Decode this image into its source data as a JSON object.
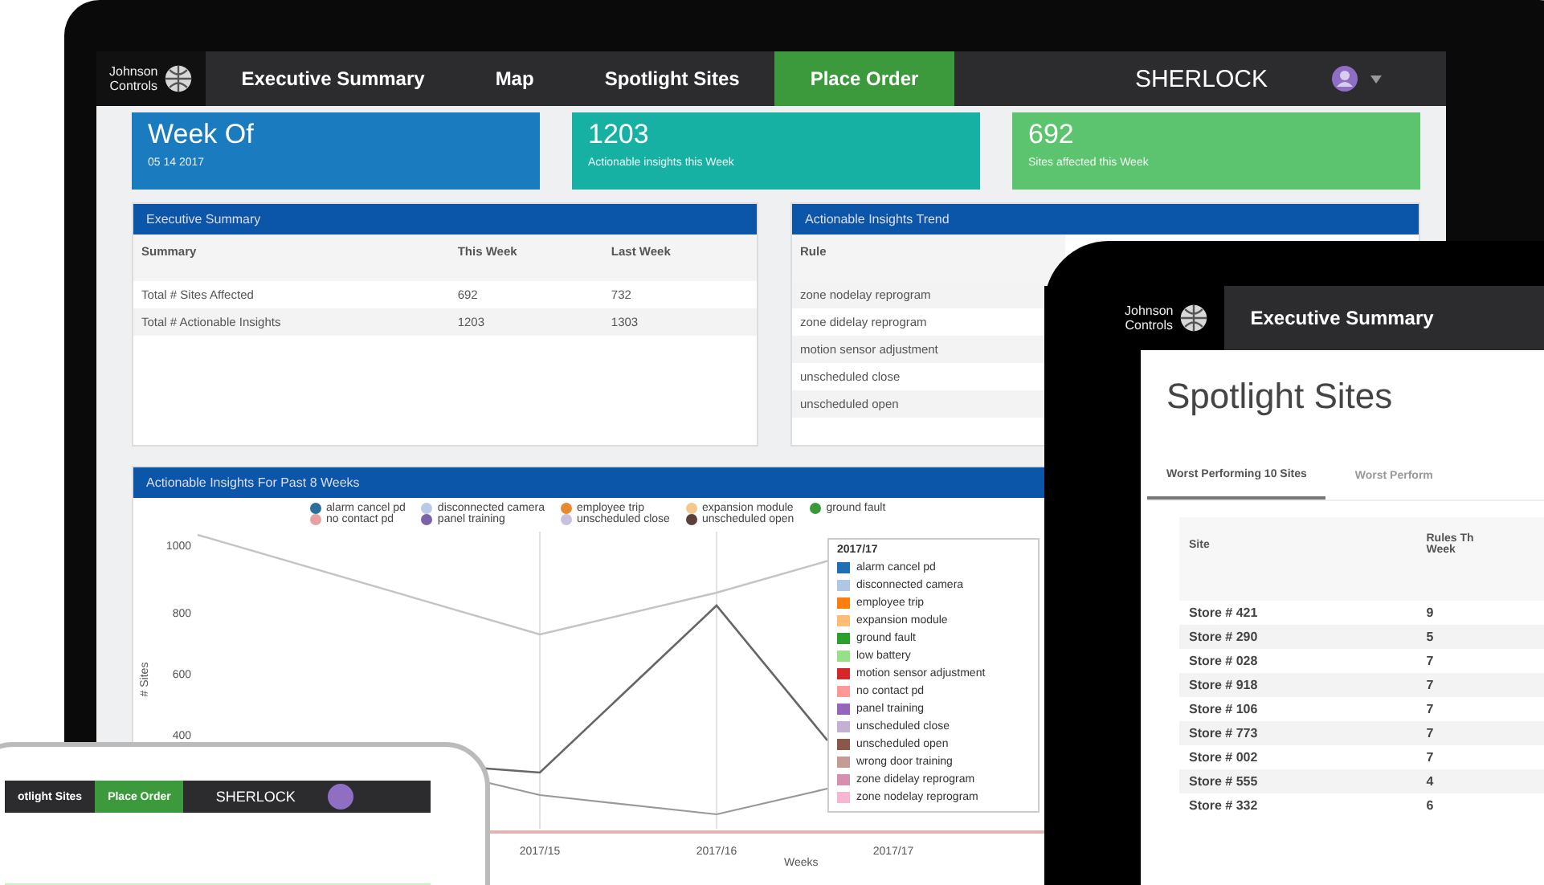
{
  "monitor": {
    "nav": {
      "logo_lines": [
        "Johnson",
        "Controls"
      ],
      "tabs": [
        {
          "label": "Executive Summary",
          "selected": false
        },
        {
          "label": "Map",
          "selected": false
        },
        {
          "label": "Spotlight Sites",
          "selected": false
        },
        {
          "label": "Place Order",
          "selected": true
        }
      ],
      "brand": "SHERLOCK"
    },
    "cards": [
      {
        "value": "Week Of",
        "caption": "05 14 2017",
        "color": "#1b7bbf"
      },
      {
        "value": "1203",
        "caption": "Actionable insights this Week",
        "color": "#17b1a3"
      },
      {
        "value": "692",
        "caption": "Sites affected this Week",
        "color": "#5cc46f"
      }
    ],
    "summary_panel": {
      "title": "Executive Summary",
      "columns": [
        "Summary",
        "This Week",
        "Last Week"
      ],
      "rows": [
        [
          "Total # Sites Affected",
          "692",
          "732"
        ],
        [
          "Total # Actionable Insights",
          "1203",
          "1303"
        ]
      ]
    },
    "trend_panel": {
      "title": "Actionable Insights Trend",
      "columns": [
        "Rule"
      ],
      "rows": [
        "zone nodelay reprogram",
        "zone didelay reprogram",
        "motion sensor adjustment",
        "unscheduled close",
        "unscheduled open"
      ]
    },
    "chart_panel": {
      "title": "Actionable Insights For Past 8 Weeks",
      "legend": [
        {
          "label": "alarm cancel pd",
          "color": "#2a6f9b"
        },
        {
          "label": "disconnected camera",
          "color": "#b9c9e6"
        },
        {
          "label": "employee trip",
          "color": "#e58a2e"
        },
        {
          "label": "expansion module",
          "color": "#f2c98f"
        },
        {
          "label": "ground fault",
          "color": "#3a9a3a"
        },
        {
          "label": "no contact pd",
          "color": "#e6a0a0"
        },
        {
          "label": "panel training",
          "color": "#7a63a8"
        },
        {
          "label": "unscheduled close",
          "color": "#c8c0dc"
        },
        {
          "label": "unscheduled open",
          "color": "#5b3f3a"
        }
      ],
      "y_axis_title": "# Sites",
      "y_tick_labels": [
        "1000",
        "800",
        "600",
        "400"
      ],
      "x_axis_title": "Weeks",
      "x_tick_labels": [
        "2017/15",
        "2017/16",
        "2017/17"
      ],
      "tooltip": {
        "title": "2017/17",
        "items": [
          {
            "label": "alarm cancel pd",
            "color": "#1f6fb4"
          },
          {
            "label": "disconnected camera",
            "color": "#aec7e8"
          },
          {
            "label": "employee trip",
            "color": "#ff7f0e"
          },
          {
            "label": "expansion module",
            "color": "#ffbb78"
          },
          {
            "label": "ground fault",
            "color": "#2ca02c"
          },
          {
            "label": "low battery",
            "color": "#98df8a"
          },
          {
            "label": "motion sensor adjustment",
            "color": "#d62728"
          },
          {
            "label": "no contact pd",
            "color": "#ff9896"
          },
          {
            "label": "panel training",
            "color": "#9467bd"
          },
          {
            "label": "unscheduled close",
            "color": "#c5b0d5"
          },
          {
            "label": "unscheduled open",
            "color": "#8c564b"
          },
          {
            "label": "wrong door training",
            "color": "#c49c94"
          },
          {
            "label": "zone didelay reprogram",
            "color": "#d68fb0"
          },
          {
            "label": "zone nodelay reprogram",
            "color": "#f7b6d2"
          }
        ]
      }
    }
  },
  "tablet": {
    "nav": {
      "logo_lines": [
        "Johnson",
        "Controls"
      ],
      "tabs": [
        {
          "label": "Executive Summary",
          "selected": false
        }
      ]
    },
    "title": "Spotlight Sites",
    "tabs": [
      {
        "label": "Worst Performing 10 Sites",
        "selected": true
      },
      {
        "label": "Worst Perform",
        "selected": false
      }
    ],
    "table": {
      "columns": [
        "Site",
        "Rules Th\nWeek"
      ],
      "rows": [
        [
          "Store # 421",
          "9"
        ],
        [
          "Store # 290",
          "5"
        ],
        [
          "Store # 028",
          "7"
        ],
        [
          "Store # 918",
          "7"
        ],
        [
          "Store # 106",
          "7"
        ],
        [
          "Store # 773",
          "7"
        ],
        [
          "Store # 002",
          "7"
        ],
        [
          "Store # 555",
          "4"
        ],
        [
          "Store # 332",
          "6"
        ]
      ]
    }
  },
  "phone": {
    "nav": {
      "tabs": [
        {
          "label": "otlight Sites",
          "selected": false
        },
        {
          "label": "Place Order",
          "selected": true
        }
      ],
      "brand": "SHERLOCK"
    }
  }
}
